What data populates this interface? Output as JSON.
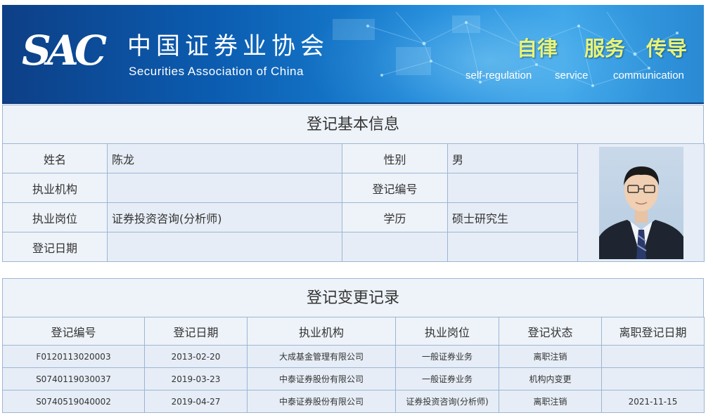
{
  "header": {
    "logo_abbr": "SAC",
    "logo_cn": "中国证券业协会",
    "logo_en": "Securities Association of China",
    "slogans": [
      {
        "cn": "自律",
        "en": "self-regulation"
      },
      {
        "cn": "服务",
        "en": "service"
      },
      {
        "cn": "传导",
        "en": "communication"
      }
    ]
  },
  "basic_info": {
    "title": "登记基本信息",
    "fields": {
      "name_label": "姓名",
      "name_value": "陈龙",
      "gender_label": "性别",
      "gender_value": "男",
      "org_label": "执业机构",
      "org_value": "",
      "reg_no_label": "登记编号",
      "reg_no_value": "",
      "position_label": "执业岗位",
      "position_value": "证券投资咨询(分析师)",
      "education_label": "学历",
      "education_value": "硕士研究生",
      "reg_date_label": "登记日期",
      "reg_date_value": ""
    },
    "photo_icon": "person-photo"
  },
  "change_records": {
    "title": "登记变更记录",
    "columns": [
      "登记编号",
      "登记日期",
      "执业机构",
      "执业岗位",
      "登记状态",
      "离职登记日期"
    ],
    "rows": [
      [
        "F0120113020003",
        "2013-02-20",
        "大成基金管理有限公司",
        "一般证券业务",
        "离职注销",
        ""
      ],
      [
        "S0740119030037",
        "2019-03-23",
        "中泰证券股份有限公司",
        "一般证券业务",
        "机构内变更",
        ""
      ],
      [
        "S0740519040002",
        "2019-04-27",
        "中泰证券股份有限公司",
        "证券投资咨询(分析师)",
        "离职注销",
        "2021-11-15"
      ]
    ]
  },
  "colors": {
    "banner_dark": "#0d3f86",
    "banner_light": "#39a3e6",
    "slogan_yellow": "#e9f476",
    "table_border": "#9bb6d4",
    "cell_bg": "#e6edf6"
  }
}
